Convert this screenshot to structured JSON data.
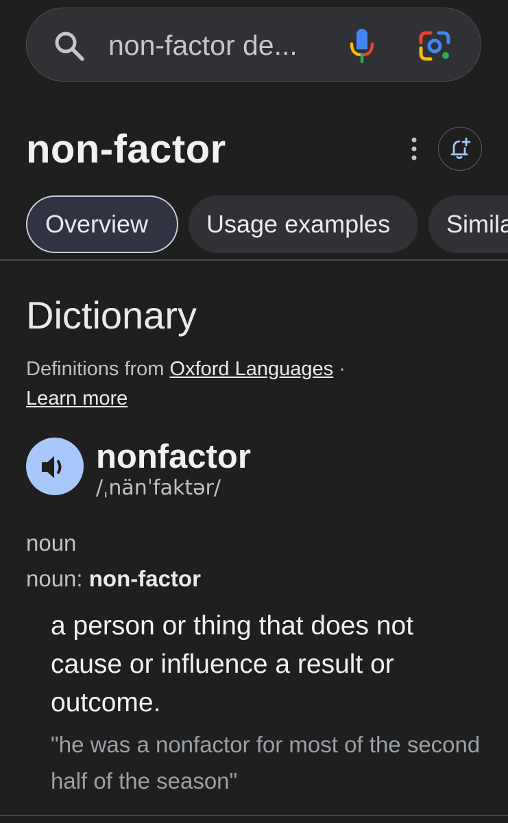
{
  "search": {
    "query": "non-factor de...",
    "icon": "search-icon",
    "mic_icon": "microphone-icon",
    "lens_icon": "google-lens-icon"
  },
  "header": {
    "title": "non-factor",
    "more_icon": "more-vert-icon",
    "alert_icon": "add-alert-bell-icon"
  },
  "tabs": [
    {
      "label": "Overview",
      "active": true
    },
    {
      "label": "Usage examples",
      "active": false
    },
    {
      "label": "Simila",
      "active": false
    }
  ],
  "dictionary": {
    "section_title": "Dictionary",
    "source_prefix": "Definitions from",
    "source_link": "Oxford Languages",
    "separator": "·",
    "learn_more": "Learn more",
    "speaker_icon": "speaker-icon",
    "headword": "nonfactor",
    "phonetic": "/ˌnänˈfaktər/",
    "part_of_speech": "noun",
    "pos_label": "noun:",
    "pos_form": "non-factor",
    "definition": "a person or thing that does not cause or influence a result or outcome.",
    "example": "\"he was a nonfactor for most of the second half of the season\""
  },
  "colors": {
    "background": "#1f1f1f",
    "search_bar": "#303134",
    "tab_bg": "#303134",
    "speaker_bg": "#a8c7fa",
    "alert_icon": "#a8c7fa"
  }
}
